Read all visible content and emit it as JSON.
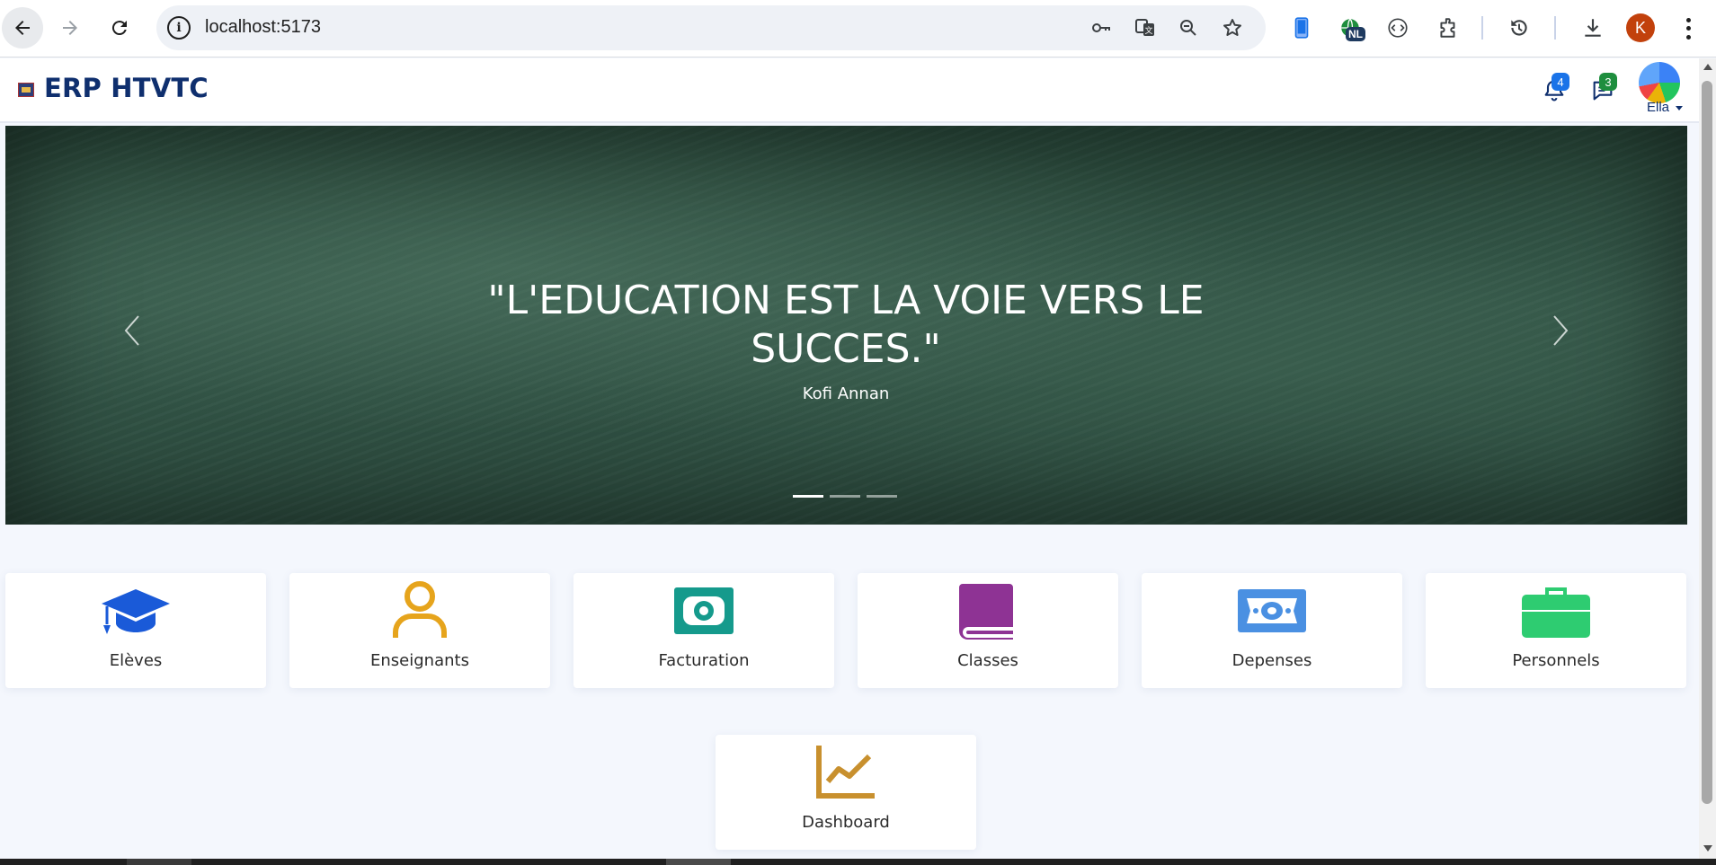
{
  "browser": {
    "url": "localhost:5173",
    "translate_badge": "NL",
    "profile_initial": "K"
  },
  "app": {
    "title": "ERP HTVTC",
    "notifications_count": "4",
    "messages_count": "3",
    "user_name": "Ella"
  },
  "hero": {
    "quote": "\"L'EDUCATION EST LA VOIE VERS LE SUCCES.\"",
    "author": "Kofi Annan",
    "slide_count": 3,
    "active_slide": 1
  },
  "modules": [
    {
      "label": "Elèves",
      "icon": "graduation-cap-icon",
      "color": "#1a5ad8"
    },
    {
      "label": "Enseignants",
      "icon": "user-icon",
      "color": "#e6a41c"
    },
    {
      "label": "Facturation",
      "icon": "money-bill-icon",
      "color": "#159a8c"
    },
    {
      "label": "Classes",
      "icon": "book-icon",
      "color": "#8e3394"
    },
    {
      "label": "Depenses",
      "icon": "money-bill-wave-icon",
      "color": "#4a90e2"
    },
    {
      "label": "Personnels",
      "icon": "briefcase-icon",
      "color": "#2ecc71"
    },
    {
      "label": "Dashboard",
      "icon": "chart-line-icon",
      "color": "#c8902e"
    }
  ]
}
